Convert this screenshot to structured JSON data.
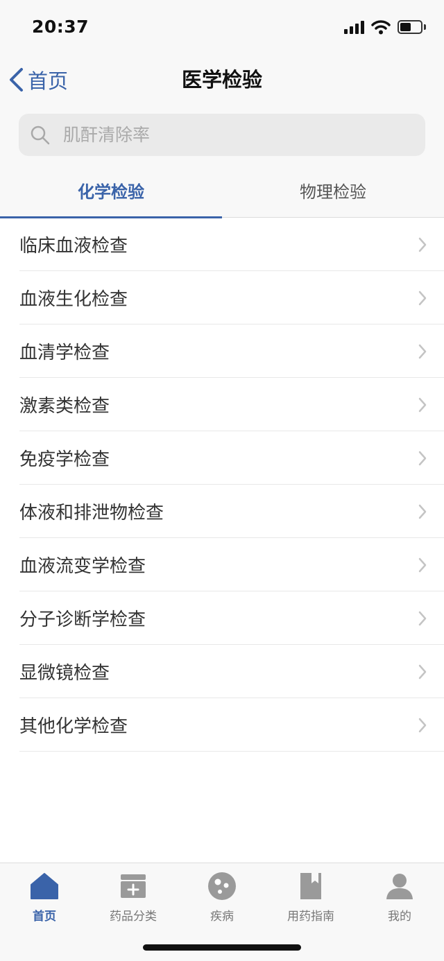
{
  "status": {
    "time": "20:37"
  },
  "nav": {
    "back_label": "首页",
    "title": "医学检验"
  },
  "search": {
    "placeholder": "肌酐清除率"
  },
  "tabs": [
    {
      "label": "化学检验",
      "active": true
    },
    {
      "label": "物理检验",
      "active": false
    }
  ],
  "list": {
    "items": [
      {
        "label": "临床血液检查"
      },
      {
        "label": "血液生化检查"
      },
      {
        "label": "血清学检查"
      },
      {
        "label": "激素类检查"
      },
      {
        "label": "免疫学检查"
      },
      {
        "label": "体液和排泄物检查"
      },
      {
        "label": "血液流变学检查"
      },
      {
        "label": "分子诊断学检查"
      },
      {
        "label": "显微镜检查"
      },
      {
        "label": "其他化学检查"
      }
    ]
  },
  "tabbar": {
    "items": [
      {
        "label": "首页",
        "icon": "home-icon",
        "active": true
      },
      {
        "label": "药品分类",
        "icon": "medicine-box-icon",
        "active": false
      },
      {
        "label": "疾病",
        "icon": "virus-icon",
        "active": false
      },
      {
        "label": "用药指南",
        "icon": "book-icon",
        "active": false
      },
      {
        "label": "我的",
        "icon": "user-icon",
        "active": false
      }
    ]
  },
  "colors": {
    "accent": "#3a63a9",
    "icon_gray": "#9a9a9a"
  }
}
